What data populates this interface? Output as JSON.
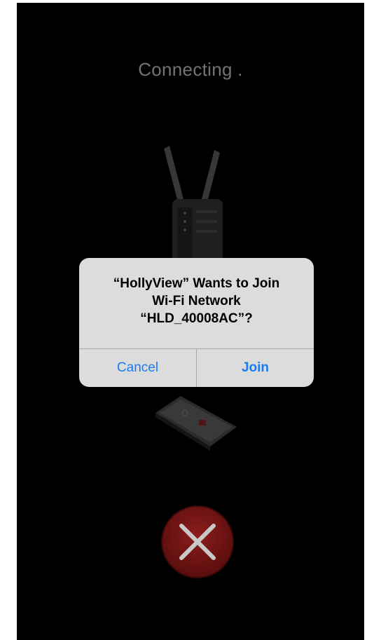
{
  "app": {
    "status_text": "Connecting ."
  },
  "alert": {
    "title": "“HollyView” Wants to Join\nWi-Fi Network\n“HLD_40008AC”?",
    "cancel_label": "Cancel",
    "join_label": "Join"
  },
  "icons": {
    "device": "wireless-transmitter-icon",
    "phone": "phone-illustration-icon",
    "close": "close-icon"
  },
  "colors": {
    "background": "#000000",
    "status_text": "#9a9a9a",
    "alert_bg": "#dcdcdc",
    "alert_button": "#1a7cf5",
    "close_button": "#7a1616"
  }
}
